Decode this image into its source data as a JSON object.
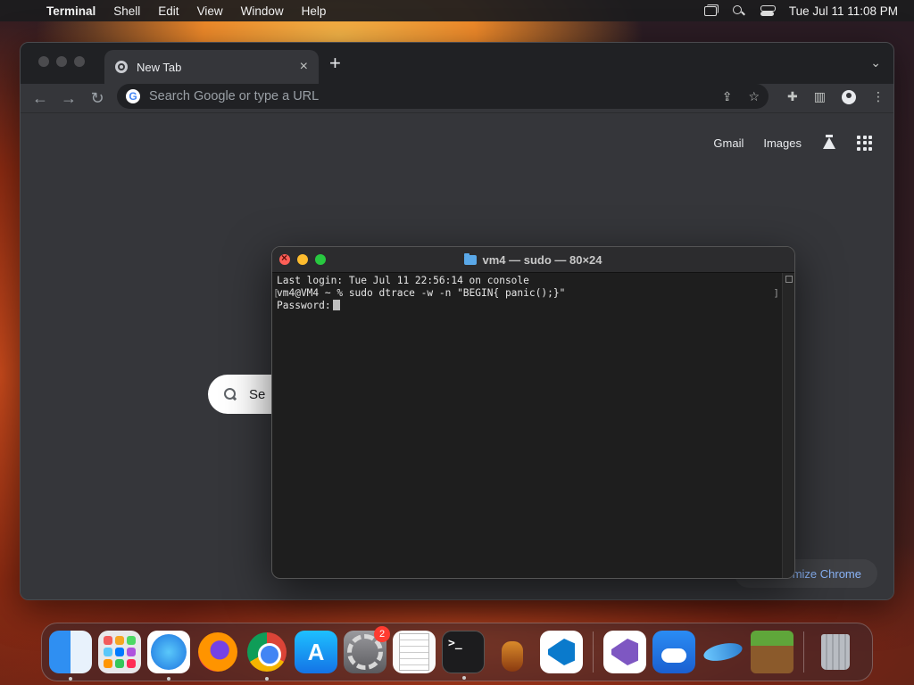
{
  "menubar": {
    "app_name": "Terminal",
    "menus": [
      "Shell",
      "Edit",
      "View",
      "Window",
      "Help"
    ],
    "clock": "Tue Jul 11  11:08 PM"
  },
  "chrome": {
    "tab_title": "New Tab",
    "omnibox_placeholder": "Search Google or type a URL",
    "links": {
      "gmail": "Gmail",
      "images": "Images"
    },
    "search_box_text": "Se",
    "customize_label": "omize Chrome"
  },
  "terminal": {
    "title": "vm4 — sudo — 80×24",
    "lines": [
      "Last login: Tue Jul 11 22:56:14 on console",
      "vm4@VM4 ~ % sudo dtrace -w -n \"BEGIN{ panic();}\"",
      "Password:"
    ]
  },
  "dock": {
    "settings_badge": "2",
    "apps": [
      {
        "name": "Finder",
        "icon": "finder-icon"
      },
      {
        "name": "Launchpad",
        "icon": "launchpad-icon"
      },
      {
        "name": "Safari",
        "icon": "safari-icon"
      },
      {
        "name": "Firefox",
        "icon": "firefox-icon"
      },
      {
        "name": "Google Chrome",
        "icon": "chrome-icon"
      },
      {
        "name": "App Store",
        "icon": "app-store-icon"
      },
      {
        "name": "System Settings",
        "icon": "settings-icon"
      },
      {
        "name": "TextEdit",
        "icon": "textedit-icon"
      },
      {
        "name": "Terminal",
        "icon": "terminal-icon"
      },
      {
        "name": "GarageBand",
        "icon": "guitar-icon"
      },
      {
        "name": "Visual Studio Code",
        "icon": "vscode-icon"
      },
      {
        "name": "Visual Studio",
        "icon": "visual-studio-icon"
      },
      {
        "name": "Weather",
        "icon": "weather-icon"
      },
      {
        "name": "Dolphin",
        "icon": "dolphin-icon"
      },
      {
        "name": "Minecraft",
        "icon": "minecraft-icon"
      },
      {
        "name": "Trash",
        "icon": "trash-icon"
      }
    ],
    "terminal_prompt_glyph": ">_"
  }
}
